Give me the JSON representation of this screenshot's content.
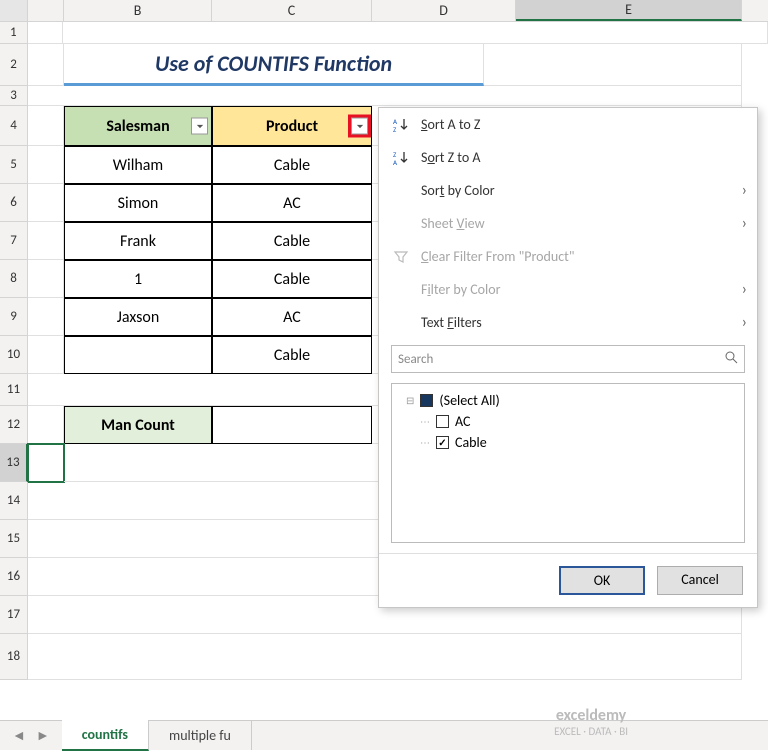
{
  "columns": {
    "B": "B",
    "C": "C",
    "D": "D",
    "E": "E"
  },
  "rows": [
    "1",
    "2",
    "3",
    "4",
    "5",
    "6",
    "7",
    "8",
    "9",
    "10",
    "11",
    "12",
    "13",
    "14",
    "15",
    "16",
    "17",
    "18"
  ],
  "title": "Use of COUNTIFS Function",
  "table": {
    "headers": {
      "salesman": "Salesman",
      "product": "Product"
    },
    "rows": [
      {
        "salesman": "Wilham",
        "product": "Cable"
      },
      {
        "salesman": "Simon",
        "product": "AC"
      },
      {
        "salesman": "Frank",
        "product": "Cable"
      },
      {
        "salesman": "1",
        "product": "Cable"
      },
      {
        "salesman": "Jaxson",
        "product": "AC"
      },
      {
        "salesman": "",
        "product": "Cable"
      }
    ],
    "man_count_label": "Man Count"
  },
  "menu": {
    "sort_az": "Sort A to Z",
    "sort_za": "Sort Z to A",
    "sort_color": "Sort by Color",
    "sheet_view": "Sheet View",
    "clear_filter": "Clear Filter From \"Product\"",
    "filter_color": "Filter by Color",
    "text_filters": "Text Filters",
    "search_placeholder": "Search",
    "items": {
      "select_all": "(Select All)",
      "ac": "AC",
      "cable": "Cable"
    },
    "ok": "OK",
    "cancel": "Cancel"
  },
  "tabs": {
    "countifs": "countifs",
    "multiple": "multiple fu"
  },
  "watermark": {
    "name": "exceldemy",
    "tag": "EXCEL · DATA · BI"
  }
}
